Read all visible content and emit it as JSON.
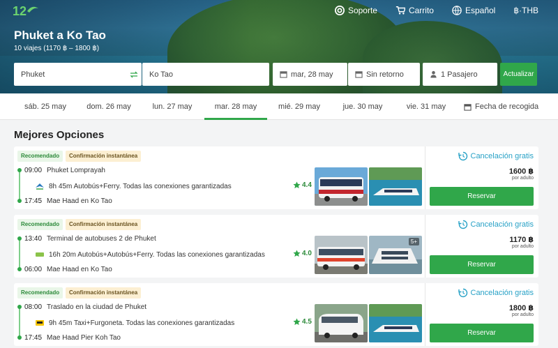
{
  "header": {
    "nav": {
      "support": "Soporte",
      "cart": "Carrito",
      "language": "Español",
      "currency": "฿·THB"
    },
    "route_title": "Phuket a Ko Tao",
    "route_subtitle": "10 viajes (1170 ฿ – 1800 ฿)"
  },
  "search": {
    "from": "Phuket",
    "to": "Ko Tao",
    "date": "mar, 28 may",
    "return": "Sin retorno",
    "passengers": "1 Pasajero",
    "update_button": "Actualizar"
  },
  "date_tabs": [
    {
      "label": "sáb. 25 may",
      "active": false
    },
    {
      "label": "dom. 26 may",
      "active": false
    },
    {
      "label": "lun. 27 may",
      "active": false
    },
    {
      "label": "mar. 28 may",
      "active": true
    },
    {
      "label": "mié. 29 may",
      "active": false
    },
    {
      "label": "jue. 30 may",
      "active": false
    },
    {
      "label": "vie. 31 may",
      "active": false
    }
  ],
  "pickup_label": "Fecha de recogida",
  "section_title": "Mejores Opciones",
  "results": [
    {
      "badge_recommended": "Recomendado",
      "badge_instant": "Confirmación instantánea",
      "depart_time": "09:00",
      "depart_place": "Phuket Lomprayah",
      "duration_text": "8h 45m Autobús+Ferry. Todas las conexiones garantizadas",
      "rating": "4.4",
      "arrive_time": "17:45",
      "arrive_place": "Mae Haad en Ko Tao",
      "cancel_text": "Cancelación gratis",
      "price": "1600 ฿",
      "per_adult": "por adulto",
      "book_label": "Reservar",
      "operator_icon": "lomprayah-logo-icon"
    },
    {
      "badge_recommended": "Recomendado",
      "badge_instant": "Confirmación instantánea",
      "depart_time": "13:40",
      "depart_place": "Terminal de autobuses 2 de Phuket",
      "duration_text": "16h 20m Autobús+Autobús+Ferry. Todas las conexiones garantizadas",
      "rating": "4.0",
      "arrive_time": "06:00",
      "arrive_place": "Mae Haad en Ko Tao",
      "more_photos": "5+",
      "cancel_text": "Cancelación gratis",
      "price": "1170 ฿",
      "per_adult": "por adulto",
      "book_label": "Reservar",
      "operator_icon": "bus-operator-icon"
    },
    {
      "badge_recommended": "Recomendado",
      "badge_instant": "Confirmación instantánea",
      "depart_time": "08:00",
      "depart_place": "Traslado en la ciudad de Phuket",
      "duration_text": "9h 45m Taxi+Furgoneta. Todas las conexiones garantizadas",
      "rating": "4.5",
      "arrive_time": "17:45",
      "arrive_place": "Mae Haad Pier Koh Tao",
      "cancel_text": "Cancelación gratis",
      "price": "1800 ฿",
      "per_adult": "por adulto",
      "book_label": "Reservar",
      "operator_icon": "taxi-icon"
    }
  ],
  "colors": {
    "accent": "#30a74a",
    "cancel": "#27a1c6"
  }
}
